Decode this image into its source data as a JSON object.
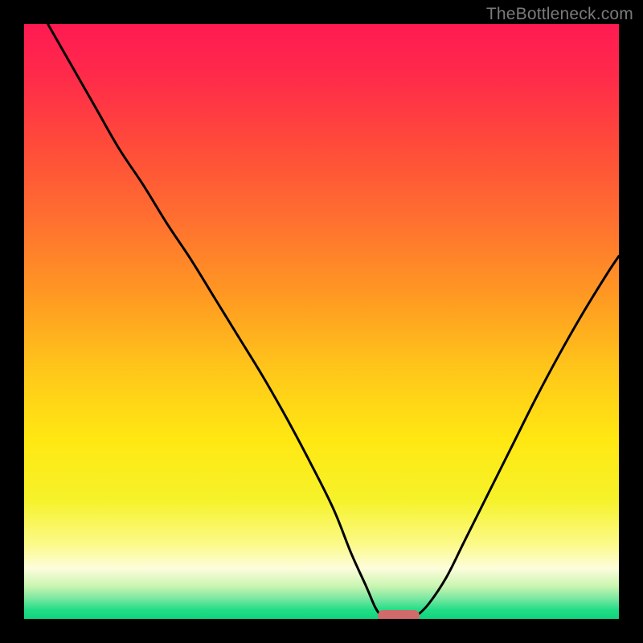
{
  "watermark": "TheBottleneck.com",
  "colors": {
    "black": "#000000",
    "gradient_stops": [
      {
        "offset": 0.0,
        "color": "#ff1a52"
      },
      {
        "offset": 0.09,
        "color": "#ff2b4a"
      },
      {
        "offset": 0.2,
        "color": "#ff4a3a"
      },
      {
        "offset": 0.33,
        "color": "#ff7030"
      },
      {
        "offset": 0.46,
        "color": "#ff9a22"
      },
      {
        "offset": 0.58,
        "color": "#ffc61a"
      },
      {
        "offset": 0.7,
        "color": "#ffe812"
      },
      {
        "offset": 0.8,
        "color": "#f6f22a"
      },
      {
        "offset": 0.875,
        "color": "#fcfa8a"
      },
      {
        "offset": 0.915,
        "color": "#fdfddc"
      },
      {
        "offset": 0.945,
        "color": "#c9f5b0"
      },
      {
        "offset": 0.965,
        "color": "#7de8a2"
      },
      {
        "offset": 0.985,
        "color": "#22dd86"
      },
      {
        "offset": 1.0,
        "color": "#11d47d"
      }
    ],
    "curve_stroke": "#000000",
    "marker": "#d06a6b"
  },
  "chart_data": {
    "type": "line",
    "title": "",
    "xlabel": "",
    "ylabel": "",
    "xlim": [
      0,
      100
    ],
    "ylim": [
      0,
      100
    ],
    "grid": false,
    "series": [
      {
        "name": "left-branch",
        "x": [
          4,
          8,
          12,
          16,
          20,
          24,
          28,
          32,
          36,
          40,
          44,
          48,
          52,
          55,
          57.5,
          59,
          60
        ],
        "y": [
          100,
          93,
          86,
          79,
          73,
          66.5,
          60.5,
          54,
          47.5,
          41,
          34,
          26.5,
          18.5,
          11,
          5.5,
          2,
          0.5
        ]
      },
      {
        "name": "right-branch",
        "x": [
          66,
          68,
          71,
          74,
          78,
          82,
          86,
          90,
          94,
          98,
          100
        ],
        "y": [
          0.5,
          2.5,
          7,
          13,
          21,
          29,
          37,
          44.5,
          51.5,
          58,
          61
        ]
      }
    ],
    "marker": {
      "x_start": 59.5,
      "x_end": 66.5,
      "y": 0.5
    },
    "notes": "y-values are read as percentage of plot height from bottom (0) to top (100); x-values as percentage of plot width from left (0) to right (100). Values estimated from pixel positions."
  }
}
